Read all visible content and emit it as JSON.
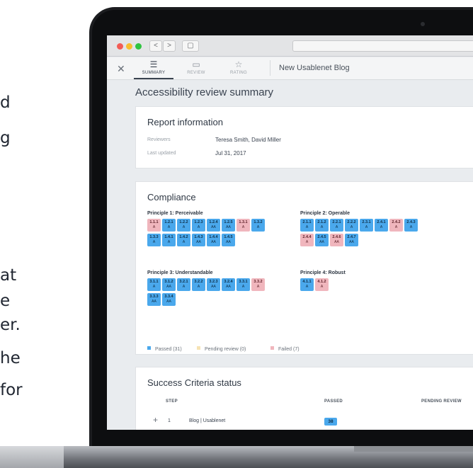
{
  "side_text": [
    "d",
    "g",
    "at",
    "e",
    "er.",
    "he",
    "for"
  ],
  "browser": {
    "back": "<",
    "forward": ">",
    "sidebar_toggle": "▢"
  },
  "toolbar": {
    "close": "✕",
    "tabs": [
      {
        "label": "SUMMARY",
        "icon": "list-icon",
        "glyph": "☰",
        "active": true
      },
      {
        "label": "REVIEW",
        "icon": "review-icon",
        "glyph": "▭",
        "active": false
      },
      {
        "label": "RATING",
        "icon": "star-icon",
        "glyph": "☆",
        "active": false
      }
    ],
    "title": "New Usablenet Blog"
  },
  "page_title": "Accessibility review summary",
  "report": {
    "title": "Report information",
    "rows": [
      {
        "label": "Reviewers",
        "value": "Teresa Smith, David Miller"
      },
      {
        "label": "Last updated",
        "value": "Jul 31, 2017"
      }
    ]
  },
  "compliance": {
    "title": "Compliance",
    "principles": [
      {
        "title": "Principle 1: Perceivable",
        "rows": [
          [
            {
              "num": "1.1.1",
              "level": "A",
              "status": "fail"
            },
            {
              "num": "1.2.1",
              "level": "A",
              "status": "pass"
            },
            {
              "num": "1.2.2",
              "level": "A",
              "status": "pass"
            },
            {
              "num": "1.2.3",
              "level": "A",
              "status": "pass"
            },
            {
              "num": "1.2.4",
              "level": "AA",
              "status": "pass"
            },
            {
              "num": "1.2.5",
              "level": "AA",
              "status": "pass"
            },
            {
              "num": "1.3.1",
              "level": "A",
              "status": "fail"
            },
            {
              "num": "1.3.2",
              "level": "A",
              "status": "pass"
            }
          ],
          [
            {
              "num": "1.3.3",
              "level": "A",
              "status": "pass"
            },
            {
              "num": "1.4.1",
              "level": "A",
              "status": "pass"
            },
            {
              "num": "1.4.2",
              "level": "A",
              "status": "pass"
            },
            {
              "num": "1.4.3",
              "level": "AA",
              "status": "pass"
            },
            {
              "num": "1.4.4",
              "level": "AA",
              "status": "pass"
            },
            {
              "num": "1.4.5",
              "level": "AA",
              "status": "pass"
            }
          ]
        ]
      },
      {
        "title": "Principle 2: Operable",
        "rows": [
          [
            {
              "num": "2.1.1",
              "level": "A",
              "status": "pass"
            },
            {
              "num": "2.1.2",
              "level": "A",
              "status": "pass"
            },
            {
              "num": "2.2.1",
              "level": "A",
              "status": "pass"
            },
            {
              "num": "2.2.2",
              "level": "A",
              "status": "pass"
            },
            {
              "num": "2.3.1",
              "level": "A",
              "status": "pass"
            },
            {
              "num": "2.4.1",
              "level": "A",
              "status": "pass"
            },
            {
              "num": "2.4.2",
              "level": "A",
              "status": "fail"
            },
            {
              "num": "2.4.3",
              "level": "A",
              "status": "pass"
            }
          ],
          [
            {
              "num": "2.4.4",
              "level": "A",
              "status": "fail"
            },
            {
              "num": "2.4.5",
              "level": "AA",
              "status": "pass"
            },
            {
              "num": "2.4.6",
              "level": "AA",
              "status": "fail"
            },
            {
              "num": "2.4.7",
              "level": "AA",
              "status": "pass"
            }
          ]
        ]
      },
      {
        "title": "Principle 3: Understandable",
        "rows": [
          [
            {
              "num": "3.1.1",
              "level": "A",
              "status": "pass"
            },
            {
              "num": "3.1.2",
              "level": "AA",
              "status": "pass"
            },
            {
              "num": "3.2.1",
              "level": "A",
              "status": "pass"
            },
            {
              "num": "3.2.2",
              "level": "A",
              "status": "pass"
            },
            {
              "num": "3.2.3",
              "level": "AA",
              "status": "pass"
            },
            {
              "num": "3.2.4",
              "level": "AA",
              "status": "pass"
            },
            {
              "num": "3.3.1",
              "level": "A",
              "status": "pass"
            },
            {
              "num": "3.3.2",
              "level": "A",
              "status": "fail"
            }
          ],
          [
            {
              "num": "3.3.3",
              "level": "AA",
              "status": "pass"
            },
            {
              "num": "3.3.4",
              "level": "AA",
              "status": "pass"
            }
          ]
        ]
      },
      {
        "title": "Principle 4: Robust",
        "rows": [
          [
            {
              "num": "4.1.1",
              "level": "A",
              "status": "pass"
            },
            {
              "num": "4.1.2",
              "level": "A",
              "status": "fail"
            }
          ]
        ]
      }
    ],
    "legend": [
      {
        "label": "Passed (31)",
        "color": "#4aa8ec"
      },
      {
        "label": "Pending review (0)",
        "color": "#f6e3b4"
      },
      {
        "label": "Failed (7)",
        "color": "#f0b6bd"
      }
    ]
  },
  "success": {
    "title": "Success Criteria status",
    "headers": {
      "step": "STEP",
      "passed": "PASSED",
      "pending": "PENDING REVIEW"
    },
    "rows": [
      {
        "expand": "+",
        "step": "1",
        "name": "Blog | Usablenet",
        "passed": "38"
      }
    ]
  }
}
